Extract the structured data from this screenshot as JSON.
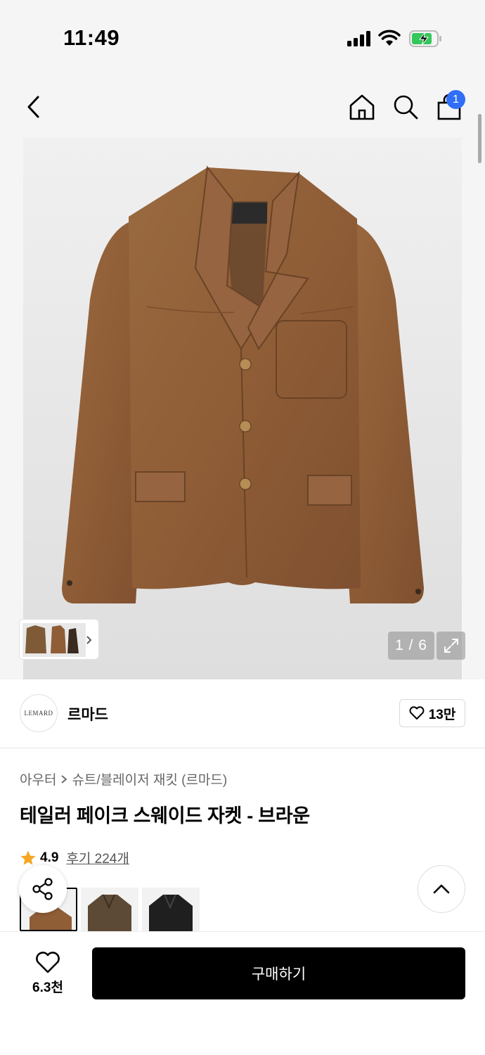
{
  "status_bar": {
    "time": "11:49"
  },
  "nav": {
    "cart_count": "1"
  },
  "gallery": {
    "counter": "1 / 6"
  },
  "brand": {
    "logo_text": "LEMARD",
    "name": "르마드",
    "likes": "13만"
  },
  "product": {
    "breadcrumb": [
      "아우터",
      "슈트/블레이저 재킷 (르마드)"
    ],
    "title": "테일러 페이크 스웨이드 자켓 - 브라운",
    "rating": "4.9",
    "review_label": "후기 224개"
  },
  "colors": {
    "brand_black": "#000000",
    "badge_blue": "#2f6ef5",
    "star": "#f5a623",
    "jacket_brown": "#8f5d36"
  },
  "bottom_bar": {
    "wishlist_count": "6.3천",
    "buy_label": "구매하기"
  }
}
